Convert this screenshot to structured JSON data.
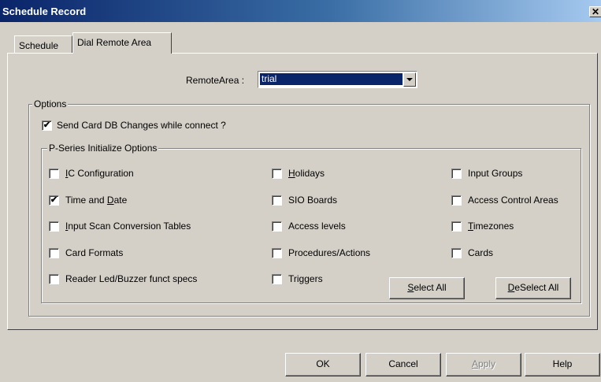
{
  "window": {
    "title": "Schedule Record",
    "close_glyph": "✕"
  },
  "tabs": [
    {
      "label": "Schedule"
    },
    {
      "label": "Dial Remote Area"
    }
  ],
  "remote_area": {
    "label": "RemoteArea :",
    "value": "trial"
  },
  "options": {
    "legend": "Options",
    "send_card_db": {
      "label": "Send Card DB Changes while connect ?",
      "checked": true
    }
  },
  "pseries": {
    "legend": "P-Series Initialize Options",
    "items": [
      {
        "pre": "",
        "u": "I",
        "post": "C Configuration",
        "checked": false
      },
      {
        "pre": "",
        "u": "H",
        "post": "olidays",
        "checked": false
      },
      {
        "pre": "Input Groups",
        "u": "",
        "post": "",
        "checked": false
      },
      {
        "pre": "Time and ",
        "u": "D",
        "post": "ate",
        "checked": true
      },
      {
        "pre": "SIO Boards",
        "u": "",
        "post": "",
        "checked": false
      },
      {
        "pre": "Access Control Areas",
        "u": "",
        "post": "",
        "checked": false
      },
      {
        "pre": "",
        "u": "I",
        "post": "nput Scan Conversion Tables",
        "checked": false
      },
      {
        "pre": "Access levels",
        "u": "",
        "post": "",
        "checked": false
      },
      {
        "pre": "",
        "u": "T",
        "post": "imezones",
        "checked": false
      },
      {
        "pre": "Card Formats",
        "u": "",
        "post": "",
        "checked": false
      },
      {
        "pre": "Procedures/Actions",
        "u": "",
        "post": "",
        "checked": false
      },
      {
        "pre": "Cards",
        "u": "",
        "post": "",
        "checked": false
      },
      {
        "pre": "Reader Led/Buzzer funct specs",
        "u": "",
        "post": "",
        "checked": false
      },
      {
        "pre": "Triggers",
        "u": "",
        "post": "",
        "checked": false
      }
    ],
    "select_all": {
      "u": "S",
      "post": "elect All"
    },
    "deselect_all": {
      "u": "D",
      "post": "eSelect All"
    }
  },
  "buttons": {
    "ok": "OK",
    "cancel": "Cancel",
    "apply": {
      "u": "A",
      "post": "pply",
      "disabled": true
    },
    "help": "Help"
  },
  "colors": {
    "title_bar": "#0a246a",
    "face": "#d4d0c8",
    "selection": "#0a246a"
  }
}
